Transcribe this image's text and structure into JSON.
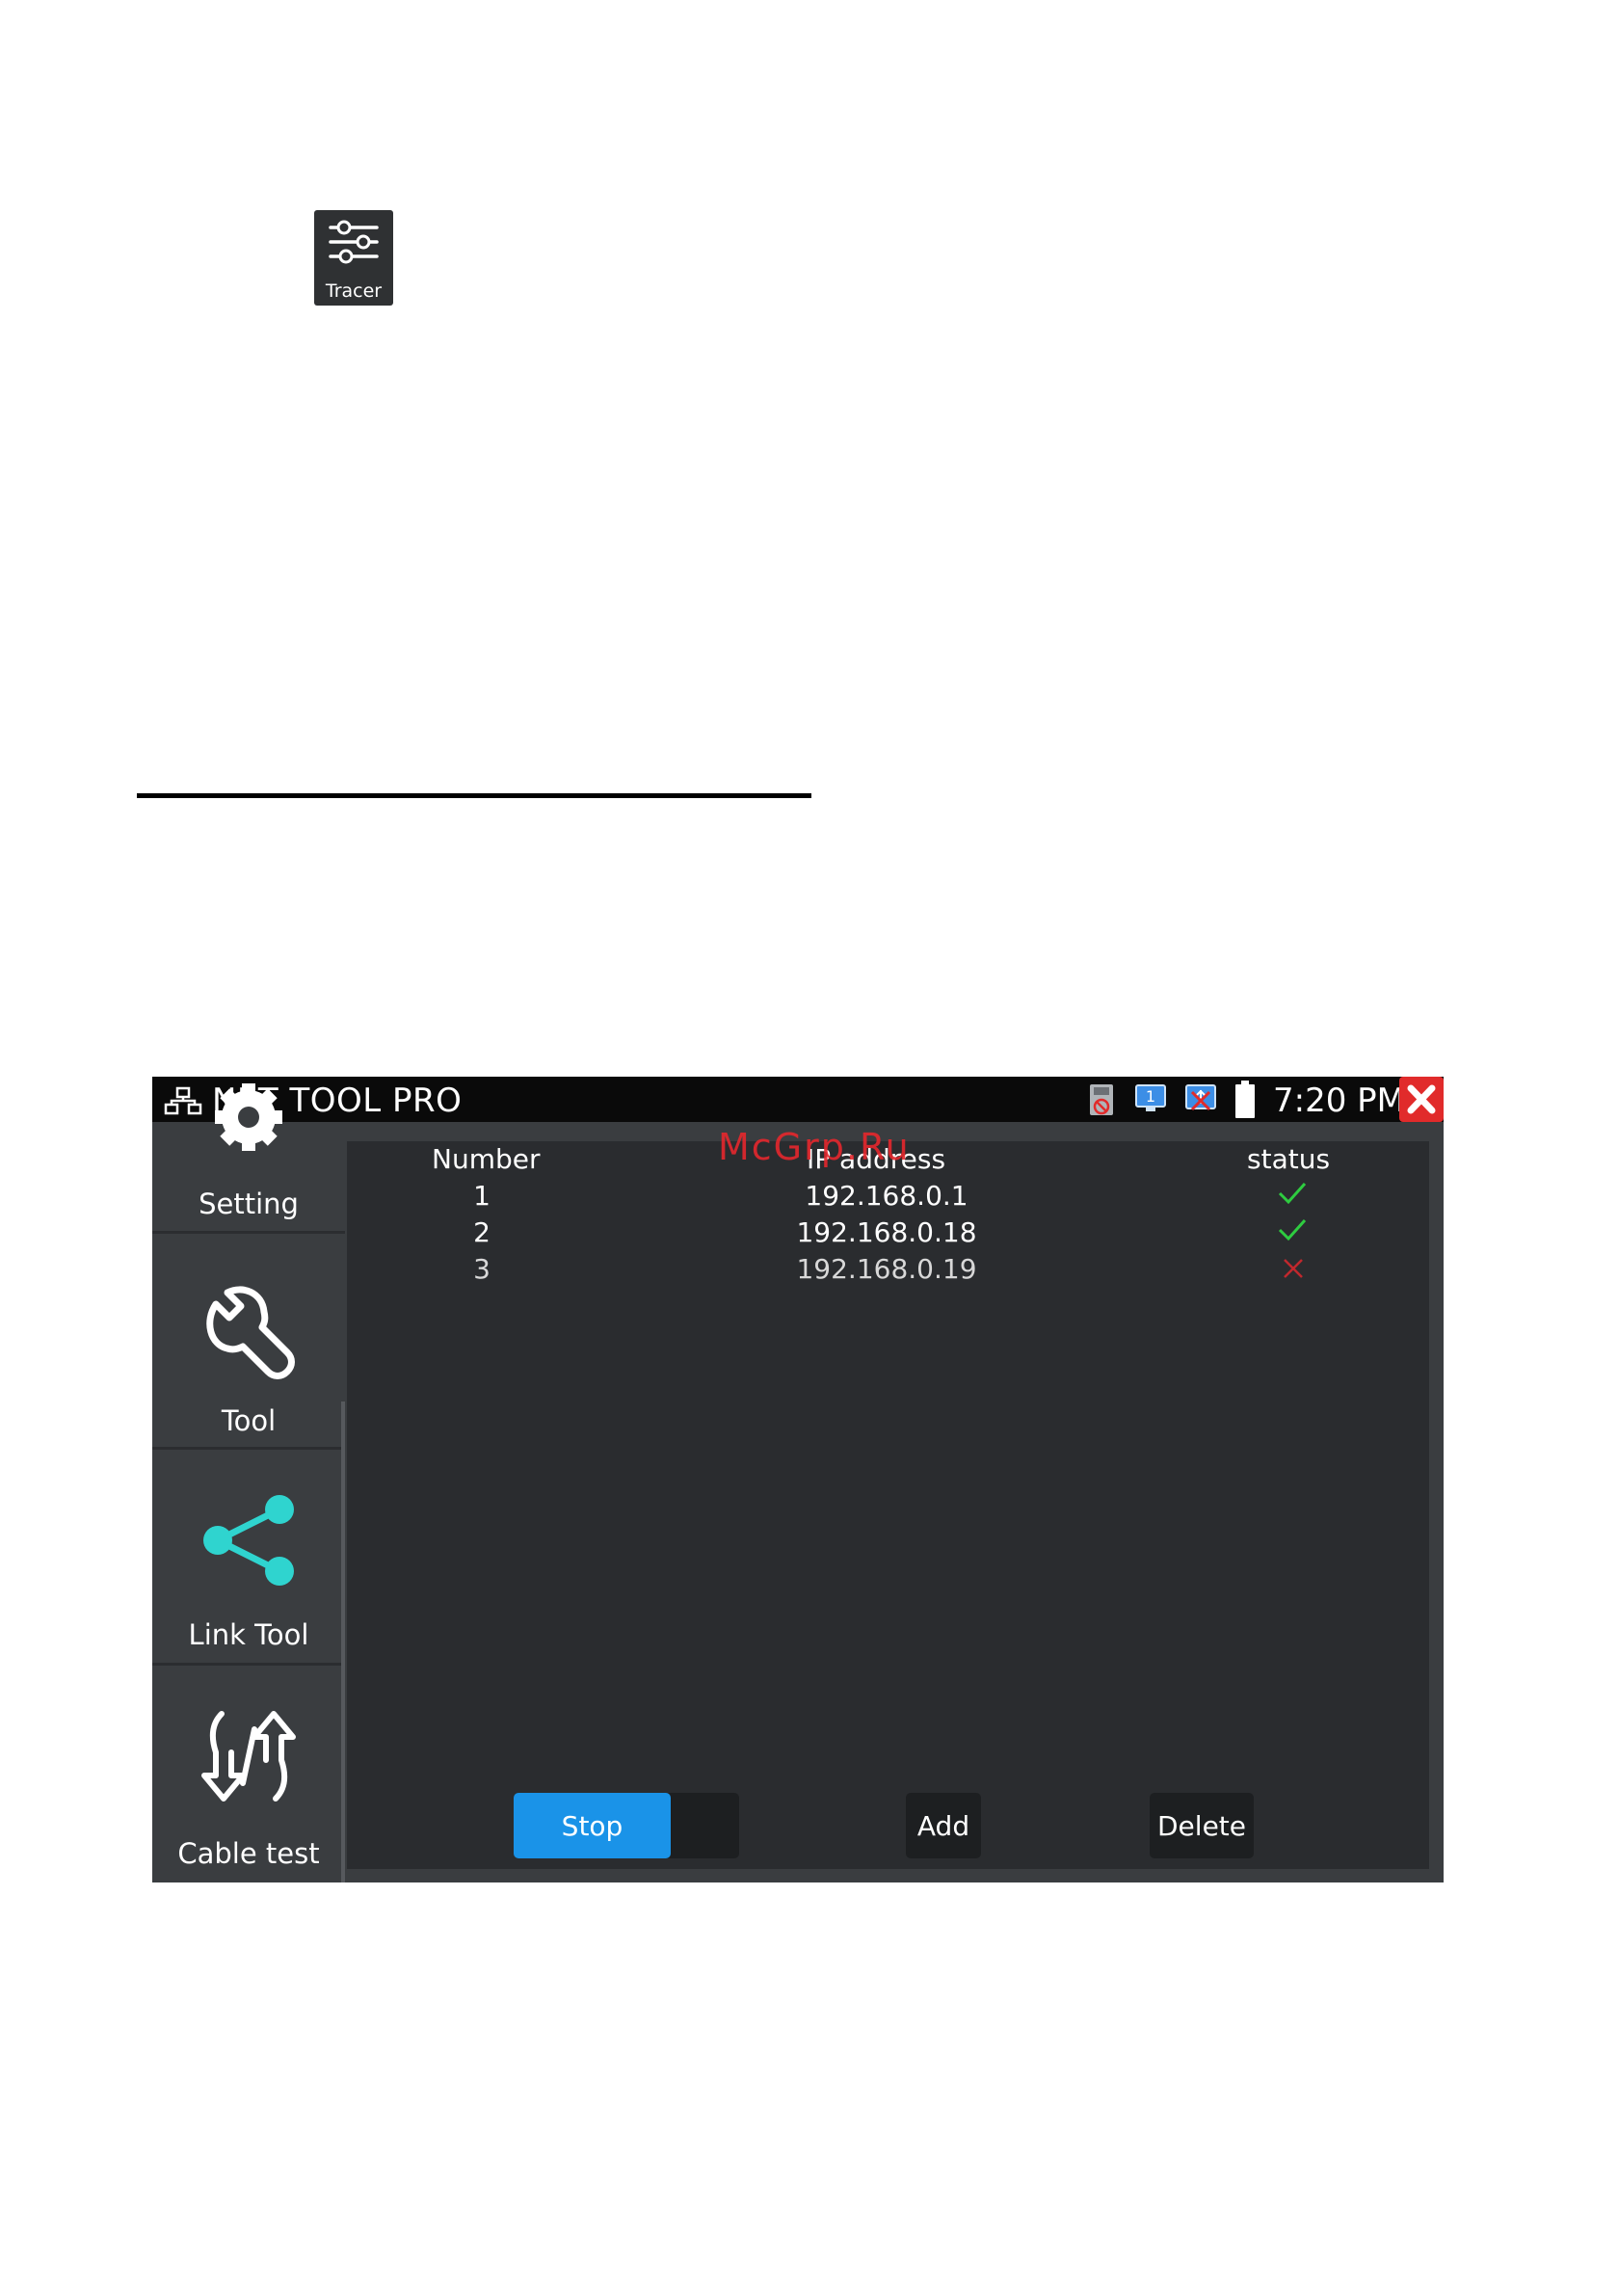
{
  "tracer_app": {
    "label": "Tracer",
    "icon": "tracer-icon"
  },
  "device": {
    "statusbar": {
      "app_title": "NET TOOL PRO",
      "time": "7:20 PM",
      "icons": [
        "network-icon",
        "sd-card-off-icon",
        "monitor-icon",
        "usb-off-icon",
        "battery-icon",
        "close-icon"
      ]
    },
    "sidebar": {
      "items": [
        {
          "label": "Setting",
          "icon": "gear-icon"
        },
        {
          "label": "Tool",
          "icon": "wrench-icon"
        },
        {
          "label": "Link Tool",
          "icon": "share-icon"
        },
        {
          "label": "Cable test",
          "icon": "cable-test-icon"
        }
      ]
    },
    "table": {
      "headers": {
        "number": "Number",
        "ip": "IP address",
        "status": "status"
      },
      "rows": [
        {
          "number": "1",
          "ip": "192.168.0.1",
          "status": "ok"
        },
        {
          "number": "2",
          "ip": "192.168.0.18",
          "status": "ok"
        },
        {
          "number": "3",
          "ip": "192.168.0.19",
          "status": "fail"
        }
      ]
    },
    "buttons": {
      "stop": "Stop",
      "add": "Add",
      "delete": "Delete"
    }
  },
  "watermark": "McGrp.Ru",
  "colors": {
    "accent": "#1a93e8",
    "ok": "#2ecc40",
    "fail": "#c0282d",
    "link_tool": "#2fd4cf",
    "close": "#e12b2b"
  }
}
